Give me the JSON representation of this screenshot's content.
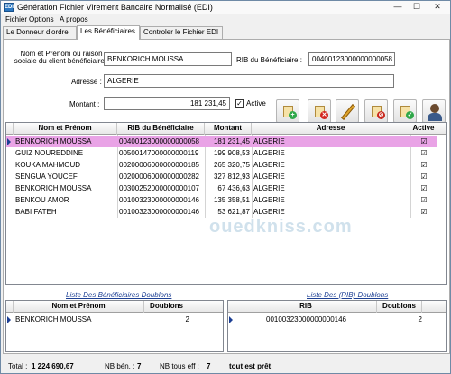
{
  "window": {
    "title": "Génération Fichier Virement Bancaire Normalisé (EDI)",
    "app_icon": "EDI",
    "controls": [
      "—",
      "☐",
      "✕"
    ]
  },
  "menu": [
    "Fichier",
    "Options",
    "A propos"
  ],
  "tabs": [
    "Le Donneur d'ordre",
    "Les Bénéficiaires",
    "Controler le Fichier EDI"
  ],
  "active_tab": 1,
  "form": {
    "name_label_line1": "Nom et Prénom ou raison",
    "name_label_line2": "sociale du client bénéficiaire :",
    "name_value": "BENKORICH    MOUSSA",
    "rib_label": "RIB du Bénéficiaire :",
    "rib_value": "00400123000000000058",
    "address_label": "Adresse :",
    "address_value": "ALGERIE",
    "amount_label": "Montant :",
    "amount_value": "181 231,45",
    "active_label": "Active",
    "active_checked": true
  },
  "toolbar_icons": [
    "add-beneficiary-icon",
    "delete-beneficiary-icon",
    "edit-icon",
    "cancel-icon",
    "validate-icon",
    "beneficiaries-icon"
  ],
  "table": {
    "headers": [
      "Nom et Prénom",
      "RIB du Bénéficiaire",
      "Montant",
      "Adresse",
      "Active"
    ],
    "rows": [
      {
        "name": "BENKORICH    MOUSSA",
        "rib": "00400123000000000058",
        "amount": "181 231,45",
        "address": "ALGERIE",
        "active": "☑"
      },
      {
        "name": "GUIZ    NOUREDDINE",
        "rib": "00500147000000000119",
        "amount": "199 908,53",
        "address": "ALGERIE",
        "active": "☑"
      },
      {
        "name": "KOUKA    MAHMOUD",
        "rib": "00200006000000000185",
        "amount": "265 320,75",
        "address": "ALGERIE",
        "active": "☑"
      },
      {
        "name": "SENGUA    YOUCEF",
        "rib": "00200006000000000282",
        "amount": "327 812,93",
        "address": "ALGERIE",
        "active": "☑"
      },
      {
        "name": "BENKORICH    MOUSSA",
        "rib": "00300252000000000107",
        "amount": "67 436,63",
        "address": "ALGERIE",
        "active": "☑"
      },
      {
        "name": "BENKOU    AMOR",
        "rib": "00100323000000000146",
        "amount": "135 358,51",
        "address": "ALGERIE",
        "active": "☑"
      },
      {
        "name": "BABI FATEH",
        "rib": "00100323000000000146",
        "amount": "53 621,87",
        "address": "ALGERIE",
        "active": "☑"
      }
    ]
  },
  "dup_names": {
    "caption": "Liste Des Bénéficiaires Doublons",
    "headers": [
      "Nom et Prénom",
      "Doublons"
    ],
    "rows": [
      {
        "name": "BENKORICH    MOUSSA",
        "count": "2"
      }
    ]
  },
  "dup_ribs": {
    "caption": "Liste Des (RIB) Doublons",
    "headers": [
      "RIB",
      "Doublons"
    ],
    "rows": [
      {
        "rib": "00100323000000000146",
        "count": "2"
      }
    ]
  },
  "status": {
    "total_label": "Total :",
    "total_value": "1 224 690,67",
    "nb_ben_label": "NB bén. :",
    "nb_ben_value": "7",
    "nb_tous_label": "NB tous eff :",
    "nb_tous_value": "7",
    "message": "tout est prêt"
  },
  "watermark": "ouedkniss.com",
  "colors": {
    "selected_row": "#e9a3e6",
    "link_caption": "#1c3f94"
  }
}
